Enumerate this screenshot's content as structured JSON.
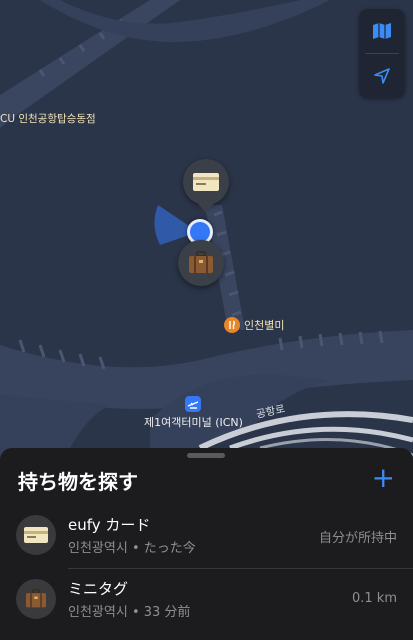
{
  "map": {
    "labels": {
      "store": "CU 인천공항탑승동점",
      "restaurant": "인천별미",
      "terminal": "제1여객터미널 (ICN)",
      "road": "공항로"
    }
  },
  "controls": {
    "map_mode_icon": "map-icon",
    "location_icon": "location-arrow-icon"
  },
  "sheet": {
    "title": "持ち物を探す",
    "add_label": "+",
    "items": [
      {
        "name": "eufy カード",
        "location": "인천광역시",
        "time": "たった今",
        "status": "自分が所持中",
        "icon": "card-icon"
      },
      {
        "name": "ミニタグ",
        "location": "인천광역시",
        "time": "33 分前",
        "status": "0.1 km",
        "icon": "suitcase-icon"
      }
    ],
    "separator": " • "
  },
  "colors": {
    "map_bg": "#2b3549",
    "accent": "#3b8cf5",
    "user_dot": "#3478f6"
  }
}
